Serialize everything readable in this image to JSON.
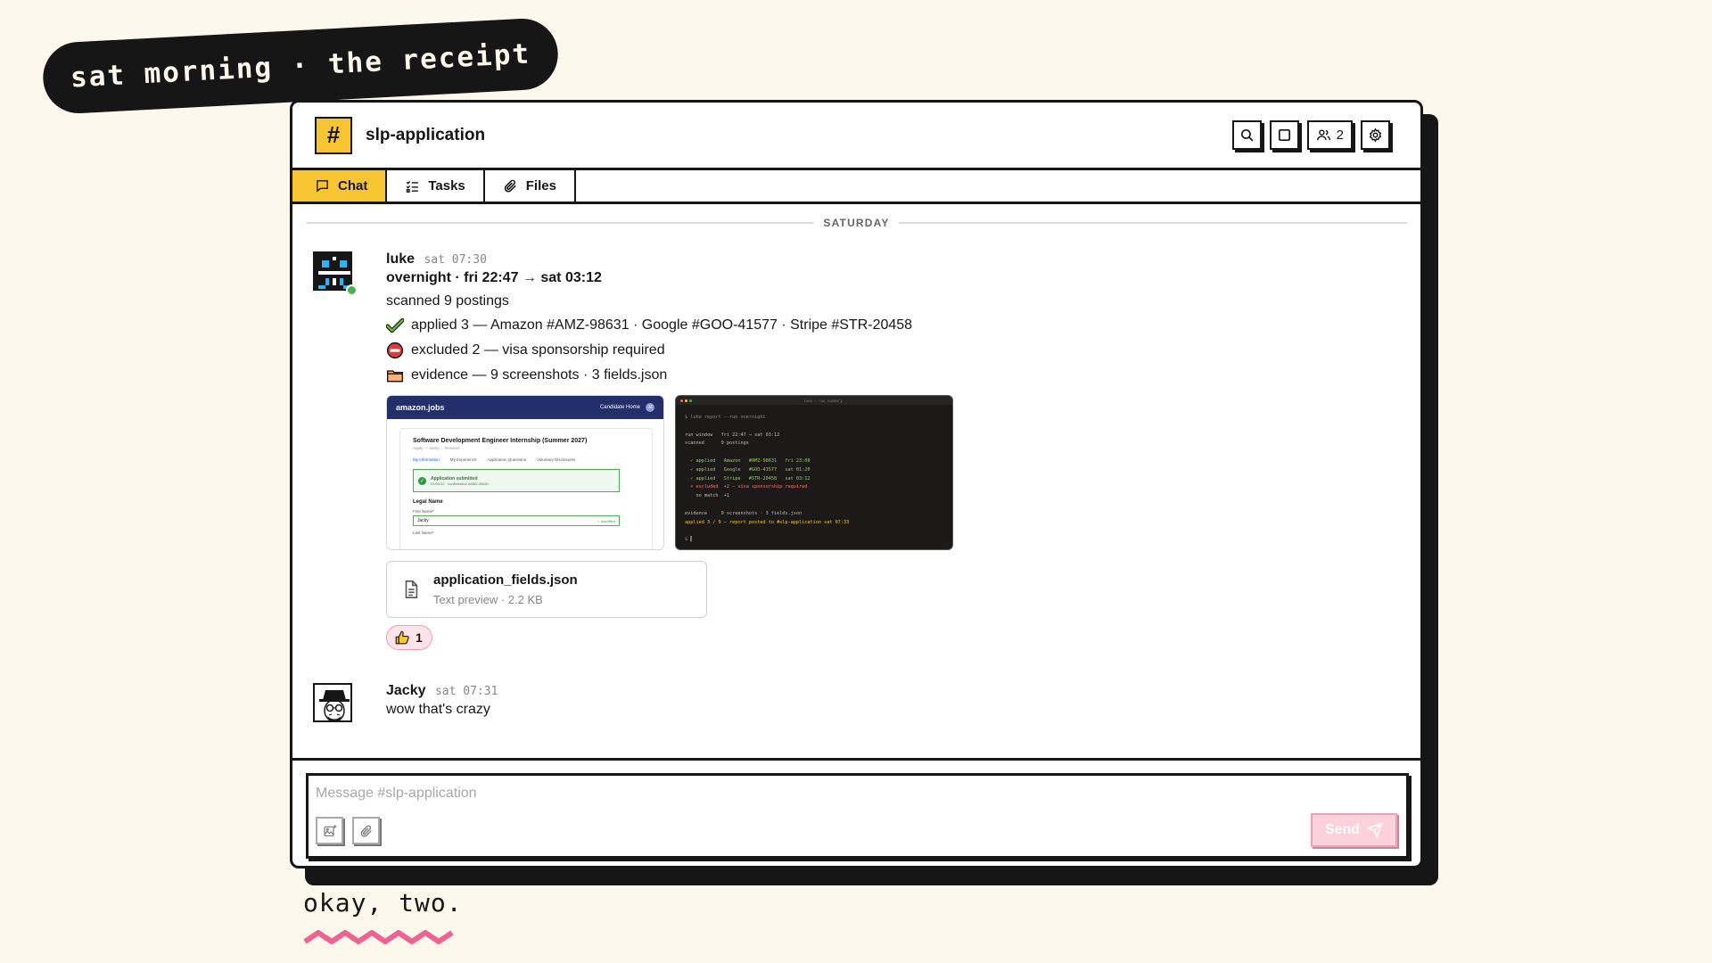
{
  "sticker": {
    "text": "sat morning · the receipt"
  },
  "channel": {
    "name": "slp-application",
    "hash": "#"
  },
  "header": {
    "members_count": "2"
  },
  "tabs": [
    {
      "label": "Chat"
    },
    {
      "label": "Tasks"
    },
    {
      "label": "Files"
    }
  ],
  "chat": {
    "day_label": "SATURDAY",
    "messages": [
      {
        "author": "luke",
        "time": "sat 07:30",
        "lines": [
          "overnight · fri 22:47 → sat 03:12",
          "scanned 9 postings",
          "applied 3 — Amazon #AMZ-98631 · Google #GOO-41577 · Stripe #STR-20458",
          "excluded 2 — visa sponsorship required",
          "evidence — 9 screenshots · 3 fields.json"
        ],
        "screenshot_amazon": {
          "brand": "amazon.jobs",
          "nav": "Candidate Home",
          "avatar_initials": "JZ",
          "job_title": "Software Development Engineer Internship (Summer 2027)",
          "apply_line": "Apply — Jacky ... Resume",
          "steps": [
            "My Information",
            "My Experience",
            "Application Questions",
            "Voluntary Disclosures"
          ],
          "success_title": "Application submitted",
          "success_detail": "03:03:32 · confirmation #AMZ-98631",
          "section": "Legal Name",
          "first_name_label": "First Name*",
          "first_name_value": "Jacky",
          "autofilled": "✓ autofilled",
          "last_name_label": "Last Name*"
        },
        "screenshot_terminal": {
          "title": "luke — run summary",
          "lines": [
            "$ luke report --run overnight",
            "",
            "run window   fri 22:47 → sat 03:12",
            "scanned      9 postings",
            "",
            "  ✓ applied   Amazon   #AMZ-98631   fri 23:08",
            "  ✓ applied   Google   #GOO-41577   sat 01:20",
            "  ✓ applied   Stripe   #STR-20458   sat 03:12",
            "  × excluded  +2 — visa sponsorship required",
            "    no match  +1",
            "",
            "evidence     9 screenshots · 3 fields.json",
            "applied 3 / 9 — report posted to #slp-application sat 07:33",
            "",
            "$ ▌"
          ]
        },
        "file": {
          "name": "application_fields.json",
          "meta": "Text preview · 2.2 KB"
        },
        "reaction": {
          "count": "1"
        }
      },
      {
        "author": "Jacky",
        "time": "sat 07:31",
        "text": "wow that's crazy"
      }
    ]
  },
  "composer": {
    "placeholder": "Message #slp-application",
    "send_label": "Send"
  },
  "caption": "okay, two.",
  "colors": {
    "accent_yellow": "#f7c531",
    "ink": "#161616",
    "paper": "#fdf8ec",
    "pink": "#f06292"
  }
}
